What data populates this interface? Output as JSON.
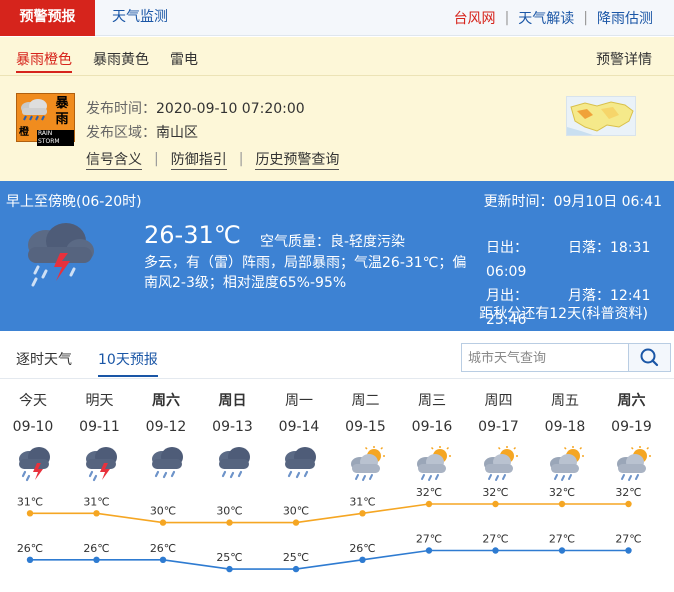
{
  "nav": {
    "warning_tab": "预警预报",
    "weather_tab": "天气监测",
    "links": [
      {
        "label": "台风网",
        "color": "#d6241c"
      },
      {
        "label": "天气解读",
        "color": "#1a56a6"
      },
      {
        "label": "降雨估测",
        "color": "#1a56a6"
      }
    ]
  },
  "warning": {
    "tabs": [
      "暴雨橙色",
      "暴雨黄色",
      "雷电"
    ],
    "active_tab": 0,
    "detail_link": "预警详情",
    "icon": {
      "glyph_top": "暴",
      "glyph_bottom": "雨",
      "level_text": "橙",
      "en_text": "RAIN STORM",
      "color": "#f08c1e"
    },
    "issue_time_label": "发布时间：",
    "issue_time": "2020-09-10 07:20:00",
    "area_label": "发布区域：",
    "area": "南山区",
    "links": [
      "信号含义",
      "防御指引",
      "历史预警查询"
    ]
  },
  "now": {
    "period": "早上至傍晚(06-20时)",
    "update_label": "更新时间：",
    "update_time": "09月10日 06:41",
    "temp": "26-31℃",
    "air_quality_label": "空气质量：",
    "air_quality": "良-轻度污染",
    "description": "多云，有（雷）阵雨，局部暴雨；气温26-31℃；偏南风2-3级；相对湿度65%-95%",
    "sunrise_label": "日出：",
    "sunrise": "06:09",
    "sunset_label": "日落：",
    "sunset": "18:31",
    "moonrise_label": "月出：",
    "moonrise": "23:46",
    "moonset_label": "月落：",
    "moonset": "12:41",
    "autumn_note": "距秋分还有12天(科普资料)",
    "icon": "thunderstorm-icon"
  },
  "forecast": {
    "tabs": [
      "逐时天气",
      "10天预报"
    ],
    "active_tab": 1,
    "search_placeholder": "城市天气查询",
    "days": [
      {
        "weekday": "今天",
        "date": "09-10",
        "icon": "thunderstorm-icon",
        "high": "31℃",
        "low": "26℃",
        "bold": false
      },
      {
        "weekday": "明天",
        "date": "09-11",
        "icon": "thunderstorm-icon",
        "high": "31℃",
        "low": "26℃",
        "bold": false
      },
      {
        "weekday": "周六",
        "date": "09-12",
        "icon": "shower-icon",
        "high": "30℃",
        "low": "26℃",
        "bold": true
      },
      {
        "weekday": "周日",
        "date": "09-13",
        "icon": "shower-icon",
        "high": "30℃",
        "low": "25℃",
        "bold": true
      },
      {
        "weekday": "周一",
        "date": "09-14",
        "icon": "shower-icon",
        "high": "30℃",
        "low": "25℃",
        "bold": false
      },
      {
        "weekday": "周二",
        "date": "09-15",
        "icon": "sunny-shower-icon",
        "high": "31℃",
        "low": "26℃",
        "bold": false
      },
      {
        "weekday": "周三",
        "date": "09-16",
        "icon": "sunny-shower-icon",
        "high": "32℃",
        "low": "27℃",
        "bold": false
      },
      {
        "weekday": "周四",
        "date": "09-17",
        "icon": "sunny-shower-icon",
        "high": "32℃",
        "low": "27℃",
        "bold": false
      },
      {
        "weekday": "周五",
        "date": "09-18",
        "icon": "sunny-shower-icon",
        "high": "32℃",
        "low": "27℃",
        "bold": false
      },
      {
        "weekday": "周六",
        "date": "09-19",
        "icon": "sunny-shower-icon",
        "high": "32℃",
        "low": "27℃",
        "bold": true
      }
    ],
    "high_color": "#f5a623",
    "low_color": "#2e7bd1"
  },
  "chart_data": {
    "type": "line",
    "categories": [
      "09-10",
      "09-11",
      "09-12",
      "09-13",
      "09-14",
      "09-15",
      "09-16",
      "09-17",
      "09-18",
      "09-19"
    ],
    "series": [
      {
        "values": [
          31,
          31,
          30,
          30,
          30,
          31,
          32,
          32,
          32,
          32
        ]
      },
      {
        "values": [
          26,
          26,
          26,
          25,
          25,
          26,
          27,
          27,
          27,
          27
        ]
      }
    ],
    "data_labels": true
  }
}
